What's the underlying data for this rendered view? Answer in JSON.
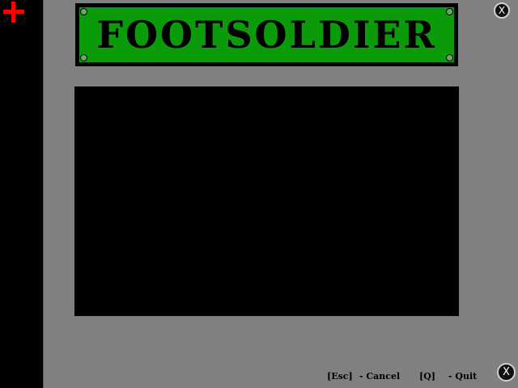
{
  "game": {
    "title": "FOOTSOLDIER"
  },
  "controls": {
    "close_top_glyph": "X",
    "close_bottom_glyph": "X",
    "hints": [
      {
        "key": "[Esc]",
        "action": "- Cancel"
      },
      {
        "key": "[Q]",
        "action": "- Quit"
      }
    ]
  },
  "colors": {
    "background": "#808080",
    "banner_green": "#0a9a0a",
    "cursor_red": "#ff0000",
    "panel_black": "#000000"
  },
  "icons": {
    "cursor": "red-crosshair-icon",
    "close": "close-icon"
  }
}
